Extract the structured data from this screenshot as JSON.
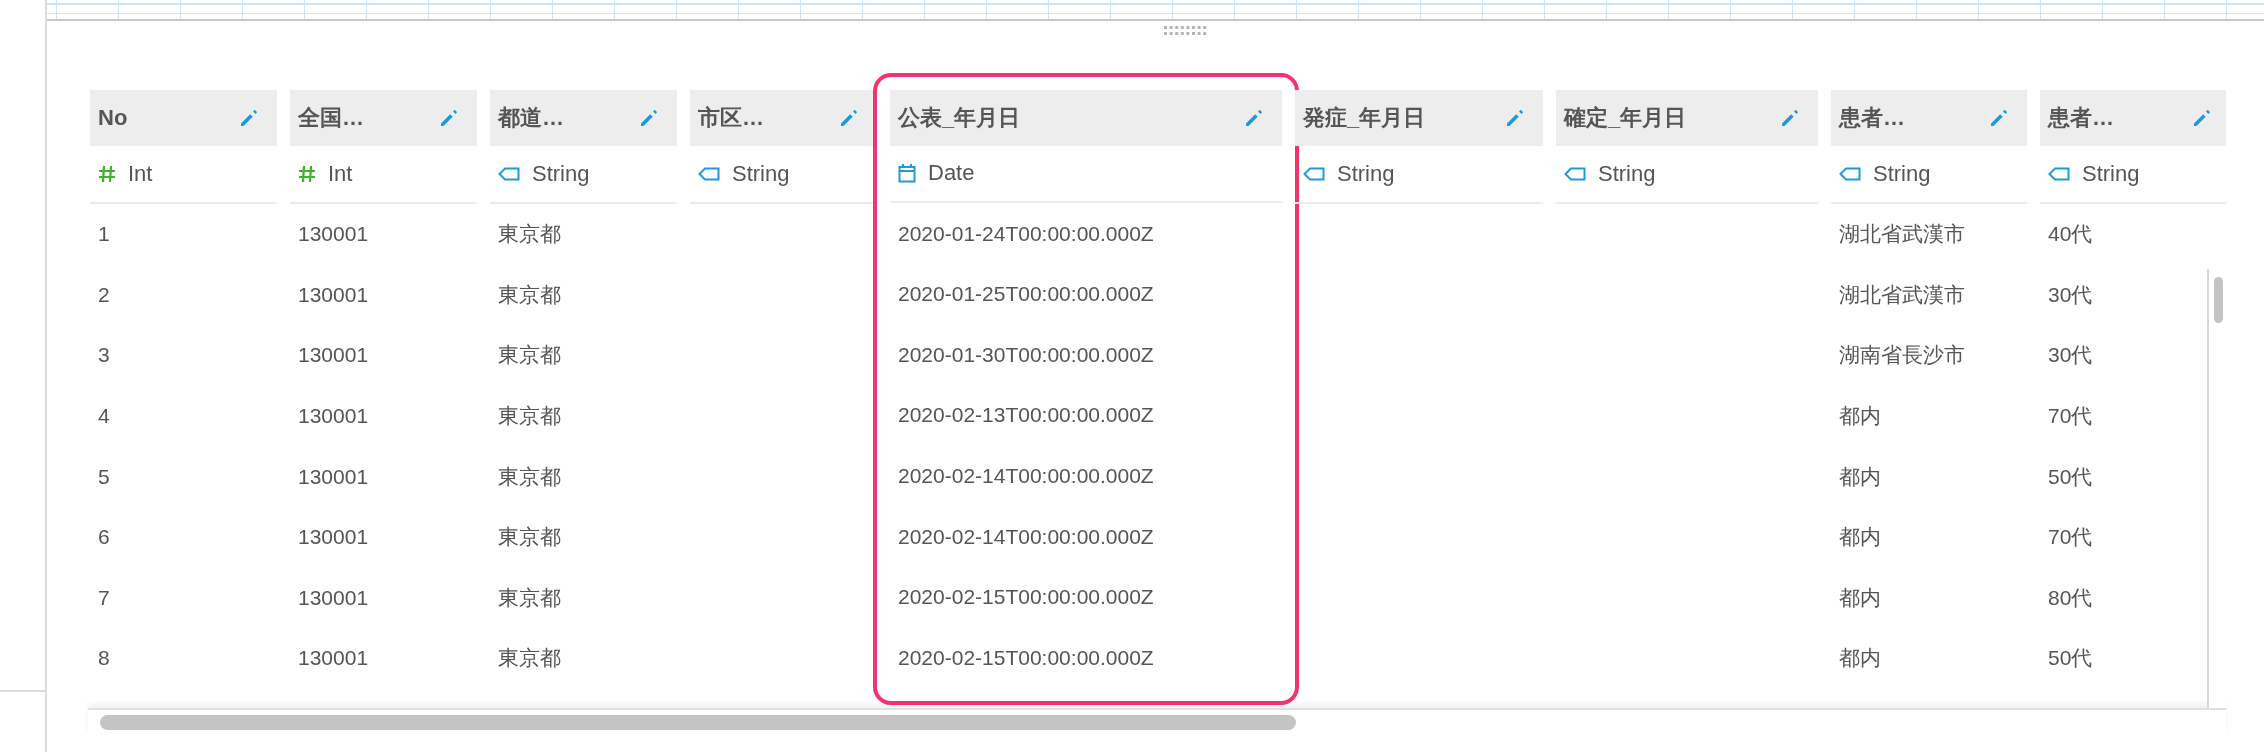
{
  "columns": [
    {
      "name": "No",
      "kind": "int",
      "type_label": "Int",
      "selected": false
    },
    {
      "name": "全国…",
      "kind": "int",
      "type_label": "Int",
      "selected": false
    },
    {
      "name": "都道…",
      "kind": "string",
      "type_label": "String",
      "selected": false
    },
    {
      "name": "市区…",
      "kind": "string",
      "type_label": "String",
      "selected": false
    },
    {
      "name": "公表_年月日",
      "kind": "date",
      "type_label": "Date",
      "selected": true
    },
    {
      "name": "発症_年月日",
      "kind": "string",
      "type_label": "String",
      "selected": false
    },
    {
      "name": "確定_年月日",
      "kind": "string",
      "type_label": "String",
      "selected": false
    },
    {
      "name": "患者…",
      "kind": "string",
      "type_label": "String",
      "selected": false
    },
    {
      "name": "患者…",
      "kind": "string",
      "type_label": "String",
      "selected": false
    }
  ],
  "rows": [
    {
      "cells": [
        "1",
        "130001",
        "東京都",
        null,
        "2020-01-24T00:00:00.000Z",
        null,
        null,
        "湖北省武漢市",
        "40代"
      ]
    },
    {
      "cells": [
        "2",
        "130001",
        "東京都",
        null,
        "2020-01-25T00:00:00.000Z",
        null,
        null,
        "湖北省武漢市",
        "30代"
      ]
    },
    {
      "cells": [
        "3",
        "130001",
        "東京都",
        null,
        "2020-01-30T00:00:00.000Z",
        null,
        null,
        "湖南省長沙市",
        "30代"
      ]
    },
    {
      "cells": [
        "4",
        "130001",
        "東京都",
        null,
        "2020-02-13T00:00:00.000Z",
        null,
        null,
        "都内",
        "70代"
      ]
    },
    {
      "cells": [
        "5",
        "130001",
        "東京都",
        null,
        "2020-02-14T00:00:00.000Z",
        null,
        null,
        "都内",
        "50代"
      ]
    },
    {
      "cells": [
        "6",
        "130001",
        "東京都",
        null,
        "2020-02-14T00:00:00.000Z",
        null,
        null,
        "都内",
        "70代"
      ]
    },
    {
      "cells": [
        "7",
        "130001",
        "東京都",
        null,
        "2020-02-15T00:00:00.000Z",
        null,
        null,
        "都内",
        "80代"
      ]
    },
    {
      "cells": [
        "8",
        "130001",
        "東京都",
        null,
        "2020-02-15T00:00:00.000Z",
        null,
        null,
        "都内",
        "50代"
      ]
    }
  ]
}
